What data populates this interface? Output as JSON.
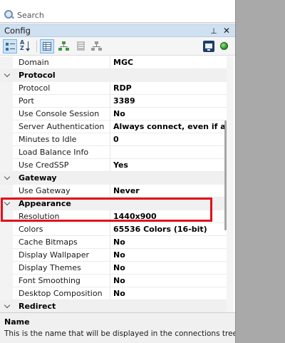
{
  "search": {
    "placeholder": "Search"
  },
  "panel": {
    "title": "Config",
    "pin_glyph": "⊥",
    "close_glyph": "✕"
  },
  "toolbar": {
    "buttons": [
      {
        "name": "categorized-view",
        "icon": "categorized-icon",
        "active": true
      },
      {
        "name": "alphabetical-view",
        "icon": "sort-az-icon",
        "active": false
      },
      {
        "name": "properties-view",
        "icon": "property-grid-icon",
        "active": true
      },
      {
        "name": "inheritance-tree",
        "icon": "tree-icon",
        "active": false
      },
      {
        "name": "property-pages",
        "icon": "pages-icon",
        "active": false
      },
      {
        "name": "default-inheritance",
        "icon": "tree-icon",
        "active": false
      },
      {
        "name": "screen-connect",
        "icon": "rdp-icon",
        "active": false
      },
      {
        "name": "host-status",
        "icon": "status-green-icon",
        "active": false
      }
    ]
  },
  "grid": {
    "rows": [
      {
        "type": "prop",
        "name": "Domain",
        "value": "MGC"
      },
      {
        "type": "category",
        "name": "Protocol"
      },
      {
        "type": "prop",
        "name": "Protocol",
        "value": "RDP"
      },
      {
        "type": "prop",
        "name": "Port",
        "value": "3389"
      },
      {
        "type": "prop",
        "name": "Use Console Session",
        "value": "No"
      },
      {
        "type": "prop",
        "name": "Server Authentication",
        "value": "Always connect, even if authe"
      },
      {
        "type": "prop",
        "name": "Minutes to Idle",
        "value": "0"
      },
      {
        "type": "prop",
        "name": "Load Balance Info",
        "value": ""
      },
      {
        "type": "prop",
        "name": "Use CredSSP",
        "value": "Yes"
      },
      {
        "type": "category",
        "name": "Gateway"
      },
      {
        "type": "prop",
        "name": "Use Gateway",
        "value": "Never"
      },
      {
        "type": "category",
        "name": "Appearance"
      },
      {
        "type": "prop",
        "name": "Resolution",
        "value": "1440x900"
      },
      {
        "type": "prop",
        "name": "Colors",
        "value": "65536 Colors (16-bit)"
      },
      {
        "type": "prop",
        "name": "Cache Bitmaps",
        "value": "No"
      },
      {
        "type": "prop",
        "name": "Display Wallpaper",
        "value": "No"
      },
      {
        "type": "prop",
        "name": "Display Themes",
        "value": "No"
      },
      {
        "type": "prop",
        "name": "Font Smoothing",
        "value": "No"
      },
      {
        "type": "prop",
        "name": "Desktop Composition",
        "value": "No"
      },
      {
        "type": "category",
        "name": "Redirect"
      }
    ]
  },
  "help": {
    "name": "Name",
    "description": "This is the name that will be displayed in the connections tree."
  },
  "colors": {
    "highlight": "#e0101c",
    "titlebar": "#cfe0f1",
    "side_panel": "#a9a9a9"
  }
}
